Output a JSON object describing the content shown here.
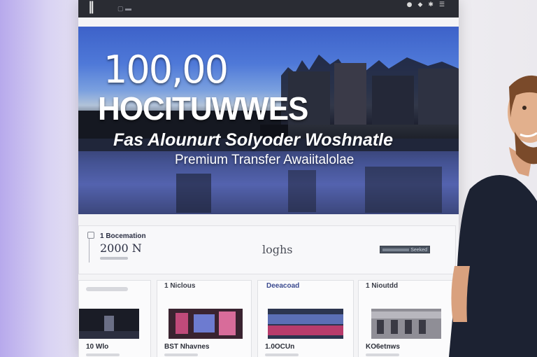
{
  "topbar": {
    "icons": [
      "user-icon",
      "bell-icon",
      "settings-icon",
      "menu-icon"
    ]
  },
  "hero": {
    "line1": "100,00",
    "line2": "HOCITUWWES",
    "tagline": "Fas Alounurt Solyoder Woshnatle",
    "subtitle": "Premium Transfer Awaiitalolae"
  },
  "info_panel": {
    "label": "1 Bocemation",
    "value": "2000 N",
    "center_text": "loghs",
    "button_label": "Seeked"
  },
  "cards": [
    {
      "caption": "",
      "title": "10 Wlo"
    },
    {
      "caption": "1 Niclous",
      "title": "BST Nhavnes"
    },
    {
      "caption": "Deeacoad",
      "title": "1.0OCUn"
    },
    {
      "caption": "1 Nioutdd",
      "title": "KO6etnws"
    }
  ],
  "colors": {
    "topbar": "#2a2c33",
    "hero_sky": "#4f79d8",
    "panel": "#f8f8fa",
    "shirt": "#1c2232"
  }
}
